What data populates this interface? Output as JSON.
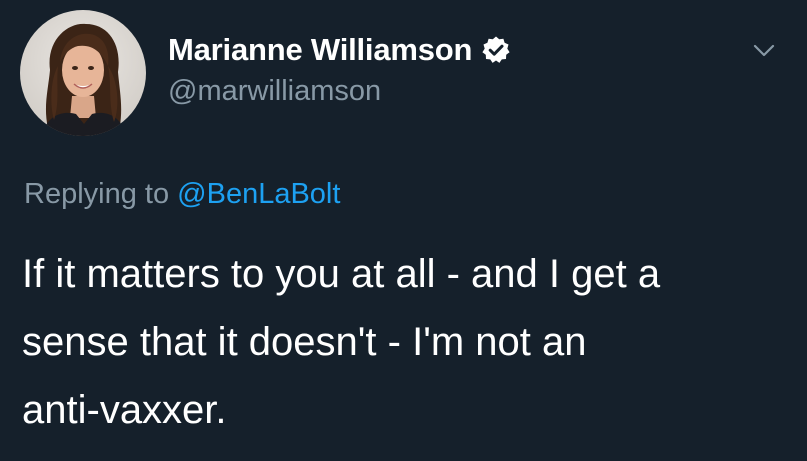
{
  "author": {
    "display_name": "Marianne Williamson",
    "handle": "@marwilliamson",
    "verified": true,
    "avatar_icon": "profile-photo"
  },
  "reply": {
    "prefix": "Replying to",
    "to_handle": "@BenLaBolt"
  },
  "tweet": {
    "lines": [
      "If it matters to you at all - and I get a",
      "sense that it doesn't - I'm not an",
      "anti-vaxxer."
    ]
  },
  "icons": {
    "verified": "verified-badge-icon",
    "menu": "chevron-down-icon"
  },
  "colors": {
    "background": "#15202b",
    "primary_text": "#ffffff",
    "secondary_text": "#8899a6",
    "link": "#1da1f2"
  }
}
